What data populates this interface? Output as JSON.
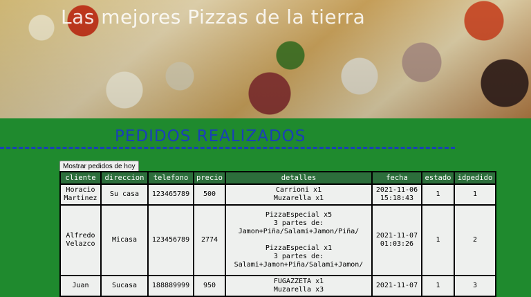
{
  "hero": {
    "title": "Las mejores Pizzas de la tierra"
  },
  "section": {
    "title": "PEDIDOS REALIZADOS"
  },
  "toolbar": {
    "show_today_label": "Mostrar pedidos de hoy"
  },
  "table": {
    "headers": [
      "cliente",
      "direccion",
      "telefono",
      "precio",
      "detalles",
      "fecha",
      "estado",
      "idpedido"
    ],
    "rows": [
      {
        "cliente": "Horacio\nMartinez",
        "direccion": "Su casa",
        "telefono": "123465789",
        "precio": "500",
        "detalles": "Carrioni x1\nMuzarella x1",
        "fecha": "2021-11-06\n15:18:43",
        "estado": "1",
        "idpedido": "1"
      },
      {
        "cliente": "Alfredo\nVelazco",
        "direccion": "Micasa",
        "telefono": "123456789",
        "precio": "2774",
        "detalles": "PizzaEspecial x5\n3 partes de:\nJamon+Piña/Salami+Jamon/Piña/\n\nPizzaEspecial x1\n3 partes de:\nSalami+Jamon+Piña/Salami+Jamon/",
        "fecha": "2021-11-07\n01:03:26",
        "estado": "1",
        "idpedido": "2"
      },
      {
        "cliente": "Juan\n",
        "direccion": "Sucasa",
        "telefono": "188889999",
        "precio": "950",
        "detalles": "FUGAZZETA x1\nMuzarella x3",
        "fecha": "2021-11-07\n",
        "estado": "1",
        "idpedido": "3"
      }
    ]
  }
}
